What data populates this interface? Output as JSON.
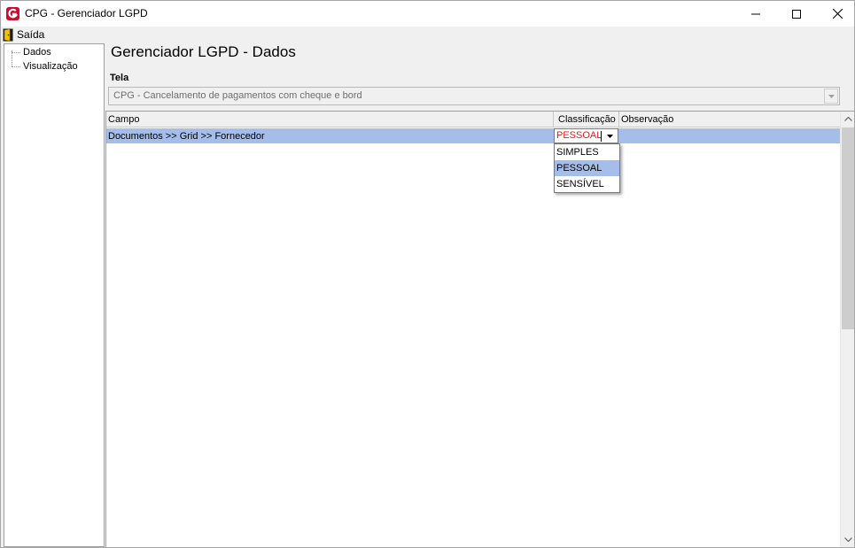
{
  "window": {
    "title": "CPG - Gerenciador LGPD",
    "icon": "cpg-logo-icon",
    "controls": [
      "minimize-icon",
      "maximize-icon",
      "close-icon"
    ]
  },
  "menubar": {
    "items": [
      {
        "label": "Saída",
        "icon": "exit-door-icon"
      }
    ]
  },
  "tree": {
    "items": [
      {
        "label": "Dados"
      },
      {
        "label": "Visualização"
      }
    ]
  },
  "main": {
    "title": "Gerenciador LGPD - Dados",
    "tela_label": "Tela",
    "tela_value": "CPG - Cancelamento de pagamentos com cheque e bord"
  },
  "grid": {
    "columns": [
      "Campo",
      "Classificação",
      "Observação"
    ],
    "rows": [
      {
        "campo": "Documentos >> Grid >> Fornecedor",
        "classificacao": "PESSOAL",
        "observacao": ""
      }
    ],
    "editor": {
      "value": "PESSOAL",
      "options": [
        "SIMPLES",
        "PESSOAL",
        "SENSÍVEL"
      ],
      "selected": "PESSOAL"
    }
  },
  "colors": {
    "selection": "#a5bde9",
    "editor_text": "#e21b1b",
    "brand_red": "#c8102e"
  }
}
